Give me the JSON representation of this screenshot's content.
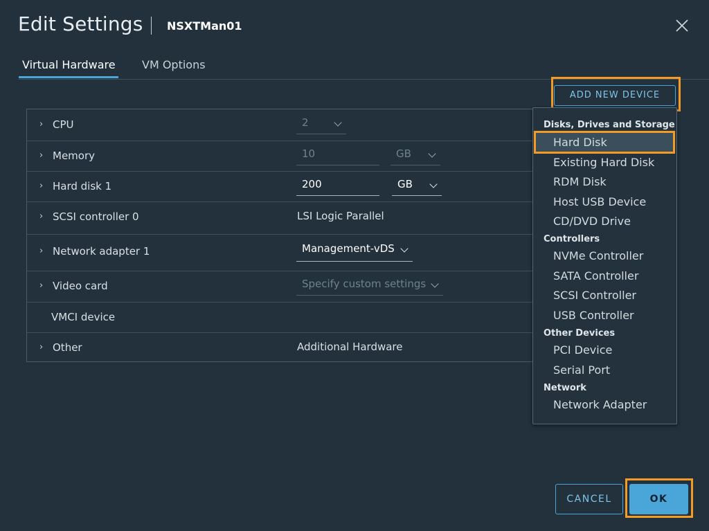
{
  "dialog": {
    "title": "Edit Settings",
    "vm_name": "NSXTMan01",
    "close_icon": "close-icon"
  },
  "tabs": [
    {
      "label": "Virtual Hardware",
      "active": true
    },
    {
      "label": "VM Options",
      "active": false
    }
  ],
  "hardware": {
    "cpu": {
      "label": "CPU",
      "value": "2"
    },
    "memory": {
      "label": "Memory",
      "value": "10",
      "unit": "GB"
    },
    "hard_disk": {
      "label": "Hard disk 1",
      "value": "200",
      "unit": "GB"
    },
    "scsi": {
      "label": "SCSI controller 0",
      "value": "LSI Logic Parallel"
    },
    "network": {
      "label": "Network adapter 1",
      "value": "Management-vDS"
    },
    "video": {
      "label": "Video card",
      "value": "Specify custom settings"
    },
    "vmci": {
      "label": "VMCI device"
    },
    "other": {
      "label": "Other",
      "value": "Additional Hardware"
    }
  },
  "add_device": {
    "label": "ADD NEW DEVICE",
    "menu": {
      "groups": [
        {
          "header": "Disks, Drives and Storage",
          "items": [
            "Hard Disk",
            "Existing Hard Disk",
            "RDM Disk",
            "Host USB Device",
            "CD/DVD Drive"
          ]
        },
        {
          "header": "Controllers",
          "items": [
            "NVMe Controller",
            "SATA Controller",
            "SCSI Controller",
            "USB Controller"
          ]
        },
        {
          "header": "Other Devices",
          "items": [
            "PCI Device",
            "Serial Port"
          ]
        },
        {
          "header": "Network",
          "items": [
            "Network Adapter"
          ]
        }
      ],
      "highlighted_item": "Hard Disk"
    }
  },
  "footer": {
    "cancel_label": "CANCEL",
    "ok_label": "OK"
  },
  "colors": {
    "background": "#22313b",
    "accent": "#4aa5d8",
    "highlight": "#f39a27"
  }
}
